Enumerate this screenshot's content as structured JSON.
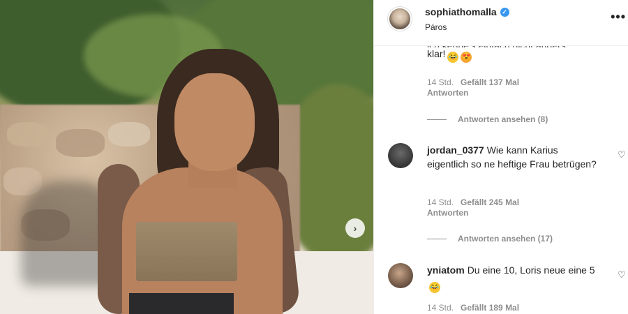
{
  "header": {
    "username": "sophiathomalla",
    "location": "Páros",
    "more_label": "•••",
    "verified_label": "✓"
  },
  "photo": {
    "next_label": "›"
  },
  "comments": [
    {
      "text_line_clipped": "ich kenne's einfach nicht anders",
      "text": "klar!",
      "emojis": [
        "face-with-tears-of-joy",
        "smiling-face-with-heart-eyes"
      ],
      "time": "14 Std.",
      "likes": "Gefällt 137 Mal",
      "reply": "Antworten",
      "view_replies": "Antworten ansehen (8)"
    },
    {
      "username": "jordan_0377",
      "text": "Wie kann Karius eigentlich so ne heftige Frau betrügen?",
      "time": "14 Std.",
      "likes": "Gefällt 245 Mal",
      "reply": "Antworten",
      "view_replies": "Antworten ansehen (17)"
    },
    {
      "username": "yniatom",
      "text": "Du eine 10, Loris neue eine 5",
      "emojis": [
        "face-with-tears-of-joy"
      ],
      "time": "14 Std.",
      "likes": "Gefällt 189 Mal"
    }
  ],
  "icons": {
    "heart": "♡",
    "joy": "😂",
    "hearteyes": "😍"
  },
  "colors": {
    "text": "#262626",
    "secondary": "#8e8e8e",
    "verified": "#3897f0",
    "divider": "#efefef"
  }
}
